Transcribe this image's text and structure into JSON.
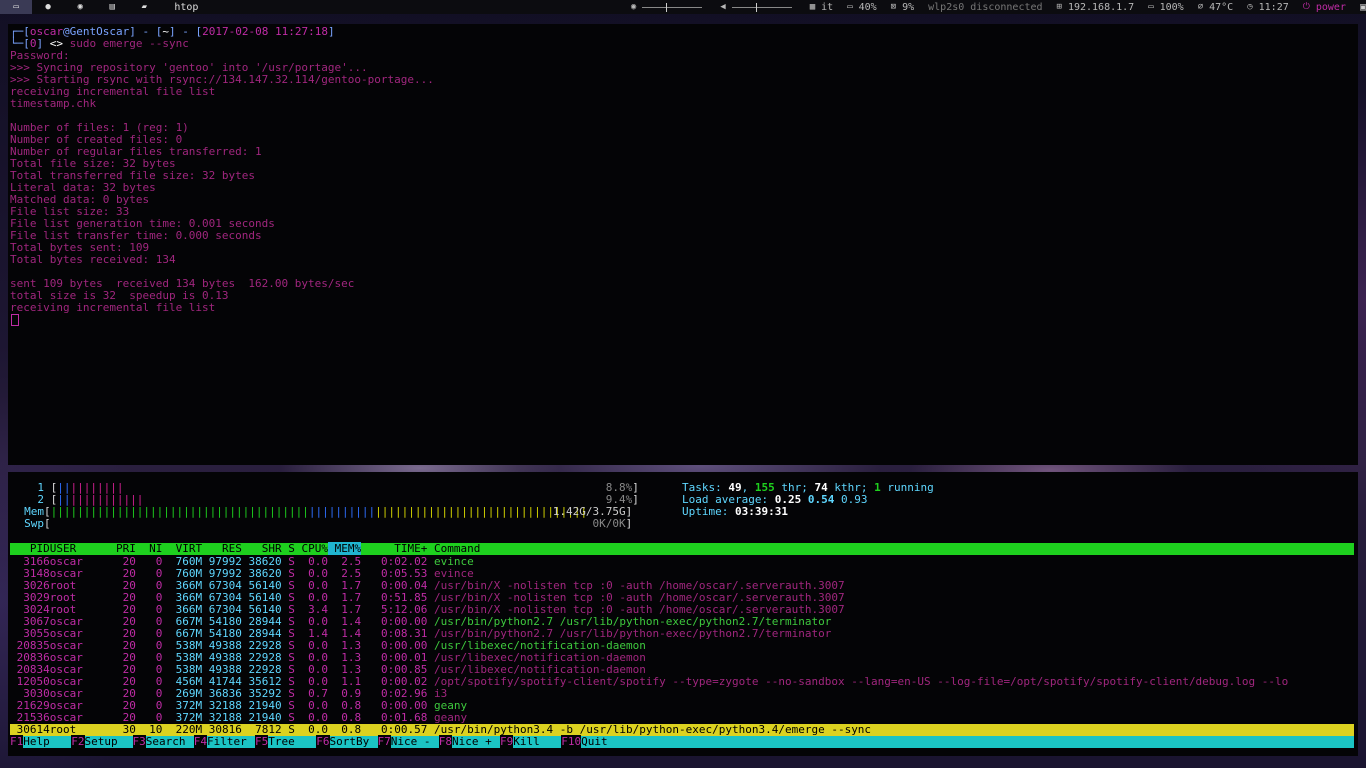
{
  "topbar": {
    "window_title": "htop",
    "layout": "it",
    "brightness": "40%",
    "brightness_level": 0.4,
    "volume_level": 0.4,
    "mute_pct": "9%",
    "wifi": "wlp2s0 disconnected",
    "ip": "192.168.1.7",
    "battery": "100%",
    "temp": "47°C",
    "clock": "11:27",
    "power": "power",
    "icons": [
      "laptop-icon",
      "firefox-icon",
      "record-icon",
      "storage-icon",
      "document-icon"
    ]
  },
  "terminal": {
    "prompt_user": "oscar",
    "prompt_host": "GentOscar",
    "prompt_dir": "~",
    "prompt_time": "2017-02-08 11:27:18",
    "prompt_status": "0",
    "command": "sudo emerge --sync",
    "lines": [
      "Password:",
      ">>> Syncing repository 'gentoo' into '/usr/portage'...",
      ">>> Starting rsync with rsync://134.147.32.114/gentoo-portage...",
      "receiving incremental file list",
      "timestamp.chk",
      "",
      "Number of files: 1 (reg: 1)",
      "Number of created files: 0",
      "Number of regular files transferred: 1",
      "Total file size: 32 bytes",
      "Total transferred file size: 32 bytes",
      "Literal data: 32 bytes",
      "Matched data: 0 bytes",
      "File list size: 33",
      "File list generation time: 0.001 seconds",
      "File list transfer time: 0.000 seconds",
      "Total bytes sent: 109",
      "Total bytes received: 134",
      "",
      "sent 109 bytes  received 134 bytes  162.00 bytes/sec",
      "total size is 32  speedup is 0.13",
      "receiving incremental file list"
    ]
  },
  "htop": {
    "cpu1": {
      "label": "1",
      "value": "8.8%"
    },
    "cpu2": {
      "label": "2",
      "value": "9.4%"
    },
    "mem": {
      "label": "Mem",
      "value": "1.42G/3.75G"
    },
    "swp": {
      "label": "Swp",
      "value": "0K/0K"
    },
    "tasks": {
      "label": "Tasks:",
      "tasks": "49",
      "thr": "155",
      "kthr": "74",
      "running": "1"
    },
    "load": {
      "label": "Load average:",
      "l1": "0.25",
      "l5": "0.54",
      "l15": "0.93"
    },
    "uptime": {
      "label": "Uptime:",
      "value": "03:39:31"
    },
    "columns": [
      "PID",
      "USER",
      "PRI",
      "NI",
      "VIRT",
      "RES",
      "SHR",
      "S",
      "CPU%",
      "MEM%",
      "TIME+",
      "Command"
    ],
    "processes": [
      {
        "pid": "3166",
        "user": "oscar",
        "pri": "20",
        "ni": "0",
        "virt": "760M",
        "res": "97992",
        "shr": "38620",
        "s": "S",
        "cpu": "0.0",
        "mem": "2.5",
        "time": "0:02.02",
        "cmd": "evince"
      },
      {
        "pid": "3148",
        "user": "oscar",
        "pri": "20",
        "ni": "0",
        "virt": "760M",
        "res": "97992",
        "shr": "38620",
        "s": "S",
        "cpu": "0.0",
        "mem": "2.5",
        "time": "0:05.53",
        "cmd": "evince"
      },
      {
        "pid": "3026",
        "user": "root",
        "pri": "20",
        "ni": "0",
        "virt": "366M",
        "res": "67304",
        "shr": "56140",
        "s": "S",
        "cpu": "0.0",
        "mem": "1.7",
        "time": "0:00.04",
        "cmd": "/usr/bin/X -nolisten tcp :0 -auth /home/oscar/.serverauth.3007"
      },
      {
        "pid": "3029",
        "user": "root",
        "pri": "20",
        "ni": "0",
        "virt": "366M",
        "res": "67304",
        "shr": "56140",
        "s": "S",
        "cpu": "0.0",
        "mem": "1.7",
        "time": "0:51.85",
        "cmd": "/usr/bin/X -nolisten tcp :0 -auth /home/oscar/.serverauth.3007"
      },
      {
        "pid": "3024",
        "user": "root",
        "pri": "20",
        "ni": "0",
        "virt": "366M",
        "res": "67304",
        "shr": "56140",
        "s": "S",
        "cpu": "3.4",
        "mem": "1.7",
        "time": "5:12.06",
        "cmd": "/usr/bin/X -nolisten tcp :0 -auth /home/oscar/.serverauth.3007"
      },
      {
        "pid": "3067",
        "user": "oscar",
        "pri": "20",
        "ni": "0",
        "virt": "667M",
        "res": "54180",
        "shr": "28944",
        "s": "S",
        "cpu": "0.0",
        "mem": "1.4",
        "time": "0:00.00",
        "cmd": "/usr/bin/python2.7 /usr/lib/python-exec/python2.7/terminator"
      },
      {
        "pid": "3055",
        "user": "oscar",
        "pri": "20",
        "ni": "0",
        "virt": "667M",
        "res": "54180",
        "shr": "28944",
        "s": "S",
        "cpu": "1.4",
        "mem": "1.4",
        "time": "0:08.31",
        "cmd": "/usr/bin/python2.7 /usr/lib/python-exec/python2.7/terminator"
      },
      {
        "pid": "20835",
        "user": "oscar",
        "pri": "20",
        "ni": "0",
        "virt": "538M",
        "res": "49388",
        "shr": "22928",
        "s": "S",
        "cpu": "0.0",
        "mem": "1.3",
        "time": "0:00.00",
        "cmd": "/usr/libexec/notification-daemon"
      },
      {
        "pid": "20836",
        "user": "oscar",
        "pri": "20",
        "ni": "0",
        "virt": "538M",
        "res": "49388",
        "shr": "22928",
        "s": "S",
        "cpu": "0.0",
        "mem": "1.3",
        "time": "0:00.01",
        "cmd": "/usr/libexec/notification-daemon"
      },
      {
        "pid": "20834",
        "user": "oscar",
        "pri": "20",
        "ni": "0",
        "virt": "538M",
        "res": "49388",
        "shr": "22928",
        "s": "S",
        "cpu": "0.0",
        "mem": "1.3",
        "time": "0:00.85",
        "cmd": "/usr/libexec/notification-daemon"
      },
      {
        "pid": "12050",
        "user": "oscar",
        "pri": "20",
        "ni": "0",
        "virt": "456M",
        "res": "41744",
        "shr": "35612",
        "s": "S",
        "cpu": "0.0",
        "mem": "1.1",
        "time": "0:00.02",
        "cmd": "/opt/spotify/spotify-client/spotify --type=zygote --no-sandbox --lang=en-US --log-file=/opt/spotify/spotify-client/debug.log --lo"
      },
      {
        "pid": "3030",
        "user": "oscar",
        "pri": "20",
        "ni": "0",
        "virt": "269M",
        "res": "36836",
        "shr": "35292",
        "s": "S",
        "cpu": "0.7",
        "mem": "0.9",
        "time": "0:02.96",
        "cmd": "i3"
      },
      {
        "pid": "21629",
        "user": "oscar",
        "pri": "20",
        "ni": "0",
        "virt": "372M",
        "res": "32188",
        "shr": "21940",
        "s": "S",
        "cpu": "0.0",
        "mem": "0.8",
        "time": "0:00.00",
        "cmd": "geany"
      },
      {
        "pid": "21536",
        "user": "oscar",
        "pri": "20",
        "ni": "0",
        "virt": "372M",
        "res": "32188",
        "shr": "21940",
        "s": "S",
        "cpu": "0.0",
        "mem": "0.8",
        "time": "0:01.68",
        "cmd": "geany"
      },
      {
        "pid": "30614",
        "user": "root",
        "pri": "30",
        "ni": "10",
        "virt": "220M",
        "res": "30816",
        "shr": "7812",
        "s": "S",
        "cpu": "0.0",
        "mem": "0.8",
        "time": "0:00.57",
        "cmd": "/usr/bin/python3.4 -b /usr/lib/python-exec/python3.4/emerge --sync"
      }
    ],
    "fkeys": [
      {
        "key": "F1",
        "label": "Help"
      },
      {
        "key": "F2",
        "label": "Setup"
      },
      {
        "key": "F3",
        "label": "Search"
      },
      {
        "key": "F4",
        "label": "Filter"
      },
      {
        "key": "F5",
        "label": "Tree"
      },
      {
        "key": "F6",
        "label": "SortBy"
      },
      {
        "key": "F7",
        "label": "Nice -"
      },
      {
        "key": "F8",
        "label": "Nice +"
      },
      {
        "key": "F9",
        "label": "Kill"
      },
      {
        "key": "F10",
        "label": "Quit"
      }
    ]
  }
}
